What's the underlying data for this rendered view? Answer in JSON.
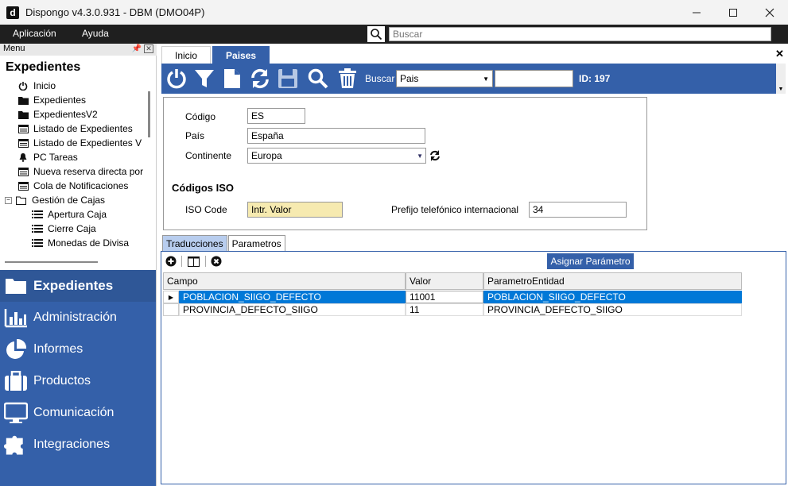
{
  "window": {
    "title": "Dispongo v4.3.0.931 - DBM (DMO04P)",
    "logo_letter": "d"
  },
  "menubar": {
    "items": [
      "Aplicación",
      "Ayuda"
    ],
    "search_placeholder": "Buscar"
  },
  "left_panel": {
    "header": "Menu",
    "title": "Expedientes",
    "tree": [
      {
        "label": "Inicio",
        "icon": "power-icon"
      },
      {
        "label": "Expedientes",
        "icon": "folder-icon"
      },
      {
        "label": "ExpedientesV2",
        "icon": "folder-icon"
      },
      {
        "label": "Listado de Expedientes",
        "icon": "list-icon"
      },
      {
        "label": "Listado de Expedientes V",
        "icon": "list-icon"
      },
      {
        "label": "PC Tareas",
        "icon": "bell-icon"
      },
      {
        "label": "Nueva reserva directa por",
        "icon": "list-icon"
      },
      {
        "label": "Cola de Notificaciones",
        "icon": "list-icon"
      },
      {
        "label": "Gestión de Cajas",
        "icon": "folder-open-icon"
      },
      {
        "label": "Apertura Caja",
        "icon": "list-icon"
      },
      {
        "label": "Cierre Caja",
        "icon": "list-icon"
      },
      {
        "label": "Monedas de Divisa",
        "icon": "list-icon"
      }
    ],
    "nav": [
      {
        "label": "Expedientes",
        "icon": "folder-icon",
        "active": true
      },
      {
        "label": "Administración",
        "icon": "bar-chart-icon",
        "active": false
      },
      {
        "label": "Informes",
        "icon": "pie-chart-icon",
        "active": false
      },
      {
        "label": "Productos",
        "icon": "suitcase-icon",
        "active": false
      },
      {
        "label": "Comunicación",
        "icon": "monitor-icon",
        "active": false
      },
      {
        "label": "Integraciones",
        "icon": "puzzle-icon",
        "active": false
      }
    ]
  },
  "tabs": [
    "Inicio",
    "Paises"
  ],
  "toolbar": {
    "search_label": "Buscar",
    "search_field": "Pais",
    "search_value": "",
    "id_label": "ID: 197"
  },
  "form": {
    "codigo_label": "Código",
    "codigo_value": "ES",
    "pais_label": "País",
    "pais_value": "España",
    "continente_label": "Continente",
    "continente_value": "Europa",
    "iso_title": "Códigos ISO",
    "iso_code_label": "ISO Code",
    "iso_code_value": "Intr. Valor",
    "prefijo_label": "Prefijo telefónico internacional",
    "prefijo_value": "34"
  },
  "subtabs": [
    "Traducciones",
    "Parametros"
  ],
  "grid": {
    "assign_button": "Asignar Parámetro",
    "columns": [
      "Campo",
      "Valor",
      "ParametroEntidad"
    ],
    "rows": [
      [
        "POBLACION_SIIGO_DEFECTO",
        "11001",
        "POBLACION_SIIGO_DEFECTO"
      ],
      [
        "PROVINCIA_DEFECTO_SIIGO",
        "11",
        "PROVINCIA_DEFECTO_SIIGO"
      ]
    ]
  }
}
